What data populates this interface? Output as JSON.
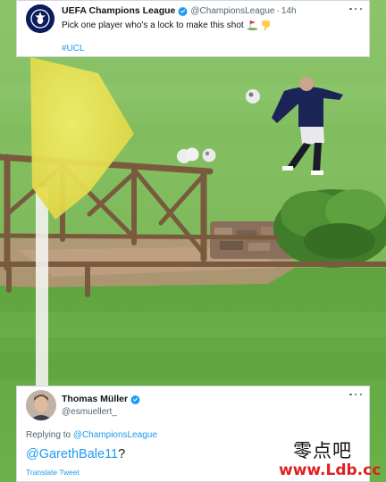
{
  "tweet": {
    "author_name": "UEFA Champions League",
    "author_handle": "@ChampionsLeague",
    "separator": "·",
    "time": "14h",
    "text": "Pick one player who's a lock to make this shot",
    "emojis": [
      "golf-flag",
      "pointing-down-hand"
    ],
    "hashtag": "#UCL"
  },
  "reply": {
    "author_name": "Thomas Müller",
    "author_handle": "@esmuellert_",
    "replying_label": "Replying to",
    "replying_handle": "@ChampionsLeague",
    "mention": "@GarethBale11",
    "suffix": "?",
    "translate_label": "Translate Tweet"
  },
  "watermark": {
    "chinese": "零点吧",
    "url": "www.Ldb.cc"
  },
  "colors": {
    "link_blue": "#1d9bf0",
    "text_dark": "#0f1419",
    "text_gray": "#536471",
    "grass": "#6aa84f",
    "watermark_red": "#e02020"
  }
}
